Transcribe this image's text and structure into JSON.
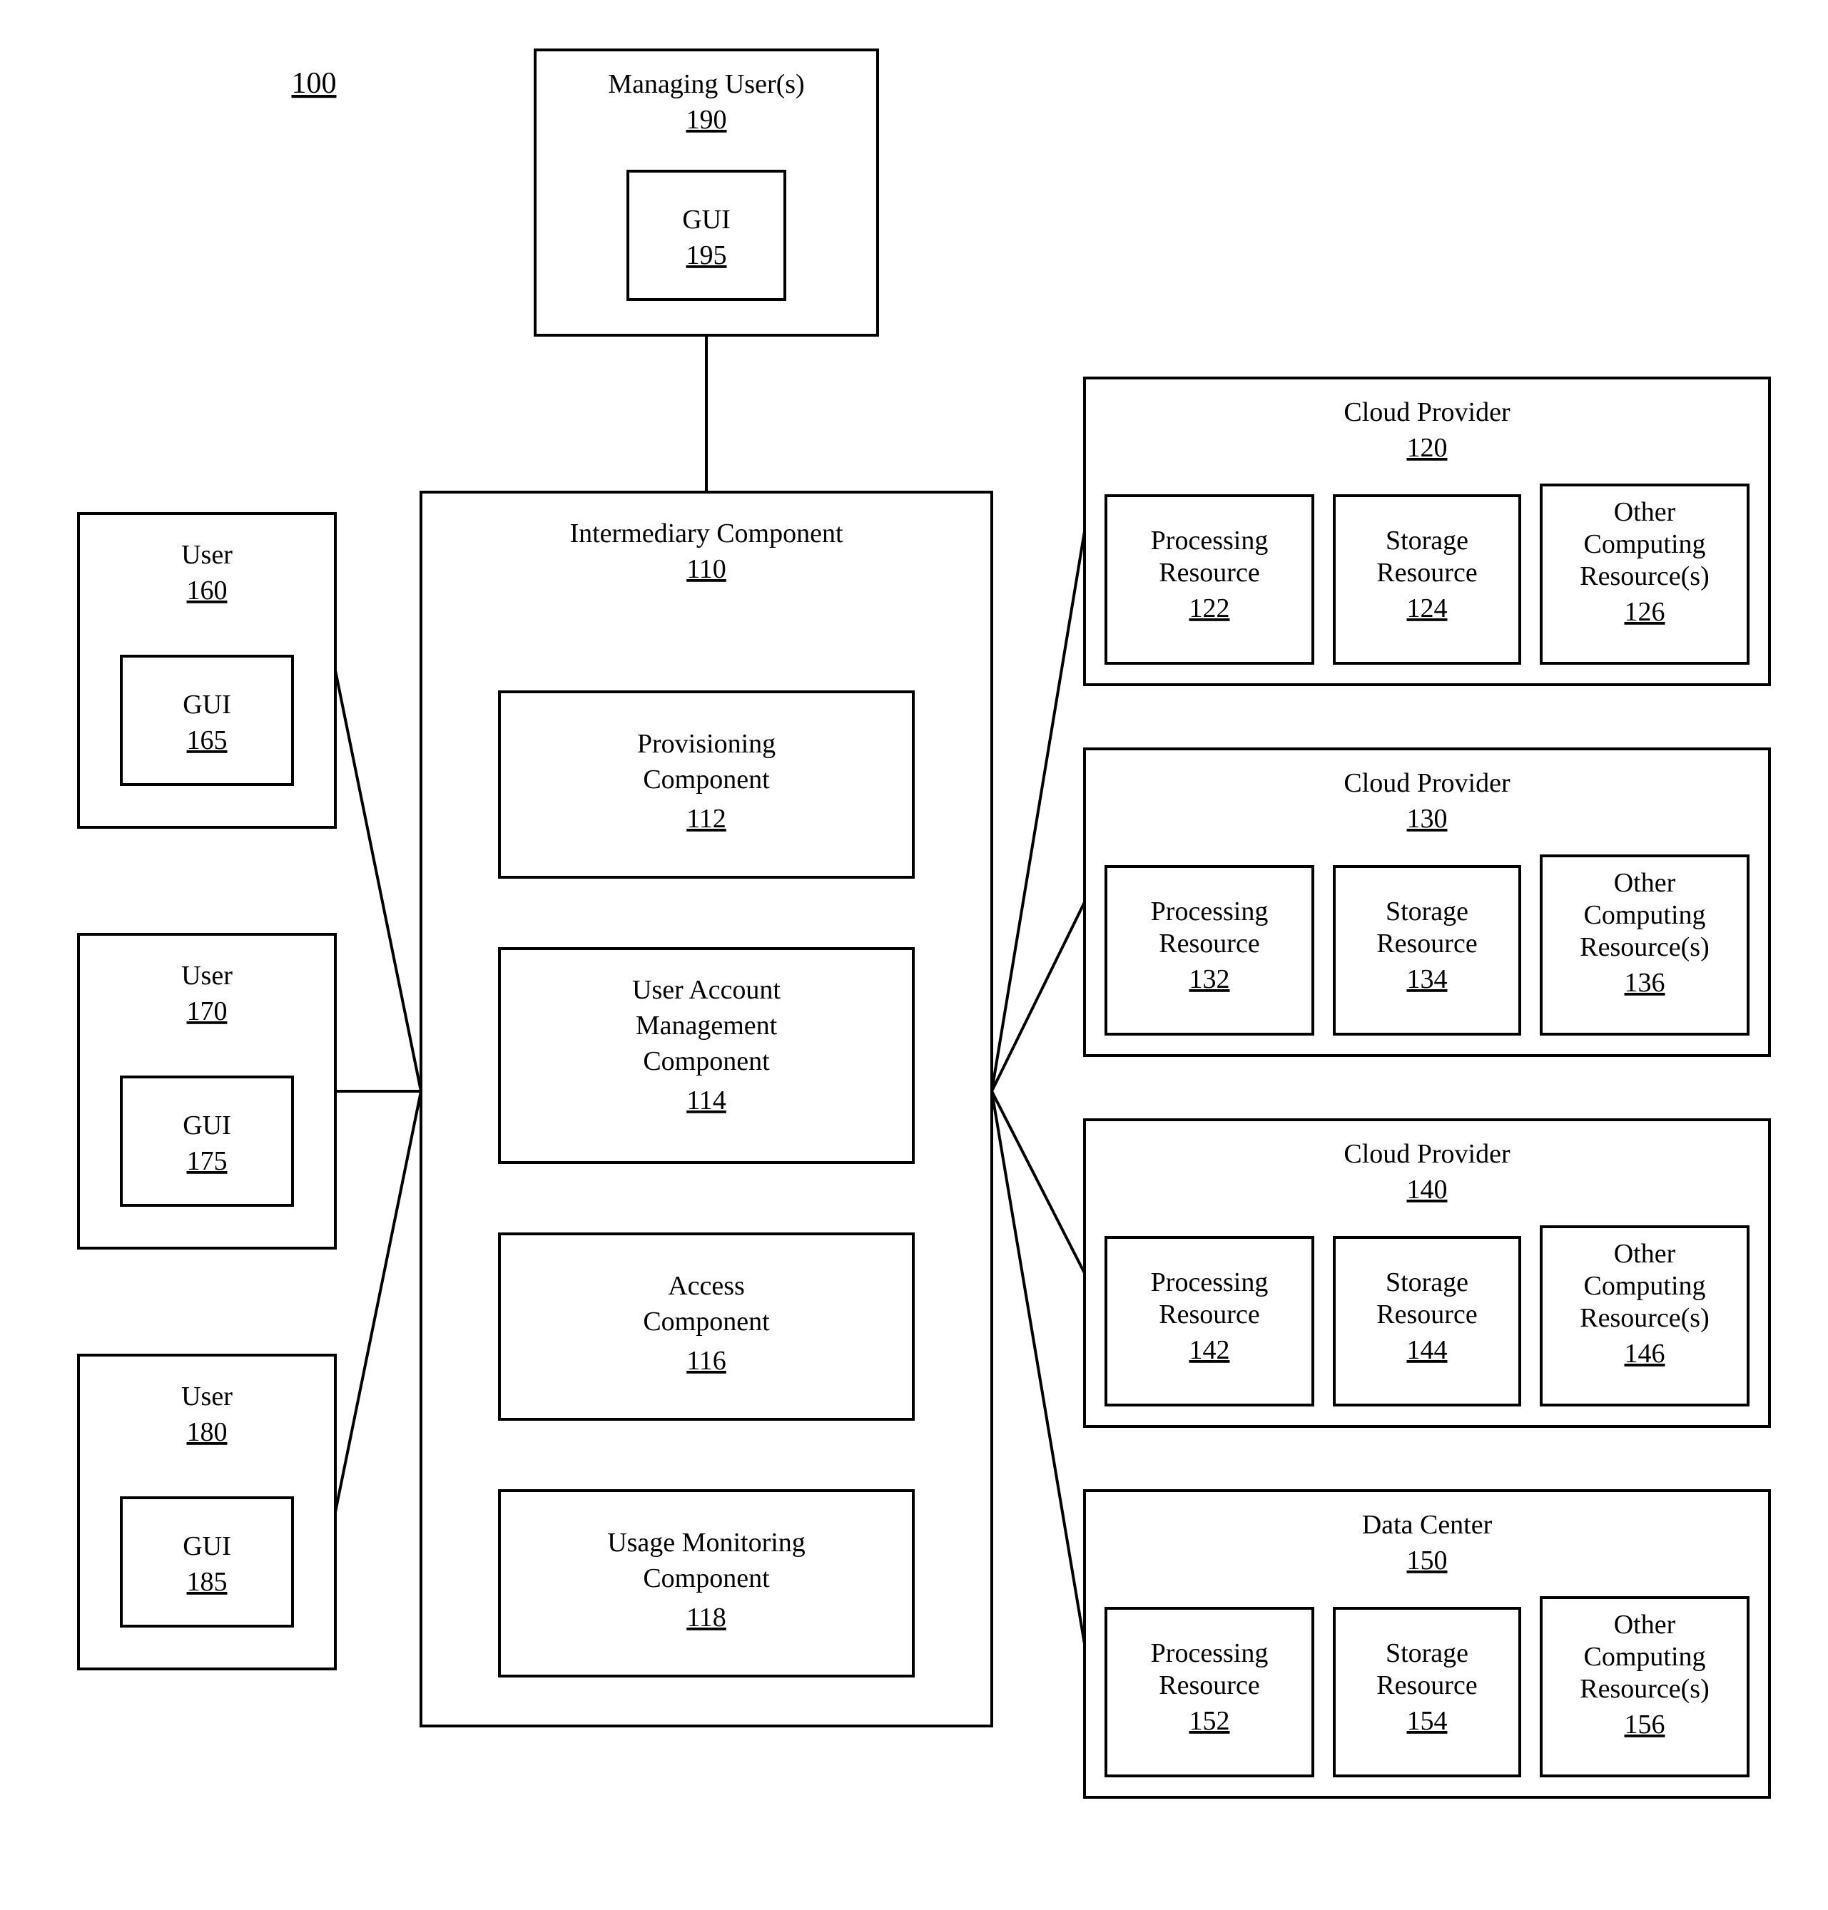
{
  "figure_number": "100",
  "managing_users": {
    "label": "Managing User(s)",
    "num": "190",
    "gui": {
      "label": "GUI",
      "num": "195"
    }
  },
  "intermediary": {
    "label": "Intermediary Component",
    "num": "110",
    "provisioning": {
      "label_l1": "Provisioning",
      "label_l2": "Component",
      "num": "112"
    },
    "user_acct": {
      "label_l1": "User Account",
      "label_l2": "Management",
      "label_l3": "Component",
      "num": "114"
    },
    "access": {
      "label_l1": "Access",
      "label_l2": "Component",
      "num": "116"
    },
    "usage": {
      "label_l1": "Usage Monitoring",
      "label_l2": "Component",
      "num": "118"
    }
  },
  "users": [
    {
      "label": "User",
      "num": "160",
      "gui_label": "GUI",
      "gui_num": "165"
    },
    {
      "label": "User",
      "num": "170",
      "gui_label": "GUI",
      "gui_num": "175"
    },
    {
      "label": "User",
      "num": "180",
      "gui_label": "GUI",
      "gui_num": "185"
    }
  ],
  "providers": [
    {
      "label": "Cloud Provider",
      "num": "120",
      "proc": {
        "l1": "Processing",
        "l2": "Resource",
        "num": "122"
      },
      "stor": {
        "l1": "Storage",
        "l2": "Resource",
        "num": "124"
      },
      "other": {
        "l1": "Other",
        "l2": "Computing",
        "l3": "Resource(s)",
        "num": "126"
      }
    },
    {
      "label": "Cloud Provider",
      "num": "130",
      "proc": {
        "l1": "Processing",
        "l2": "Resource",
        "num": "132"
      },
      "stor": {
        "l1": "Storage",
        "l2": "Resource",
        "num": "134"
      },
      "other": {
        "l1": "Other",
        "l2": "Computing",
        "l3": "Resource(s)",
        "num": "136"
      }
    },
    {
      "label": "Cloud Provider",
      "num": "140",
      "proc": {
        "l1": "Processing",
        "l2": "Resource",
        "num": "142"
      },
      "stor": {
        "l1": "Storage",
        "l2": "Resource",
        "num": "144"
      },
      "other": {
        "l1": "Other",
        "l2": "Computing",
        "l3": "Resource(s)",
        "num": "146"
      }
    },
    {
      "label": "Data Center",
      "num": "150",
      "proc": {
        "l1": "Processing",
        "l2": "Resource",
        "num": "152"
      },
      "stor": {
        "l1": "Storage",
        "l2": "Resource",
        "num": "154"
      },
      "other": {
        "l1": "Other",
        "l2": "Computing",
        "l3": "Resource(s)",
        "num": "156"
      }
    }
  ]
}
